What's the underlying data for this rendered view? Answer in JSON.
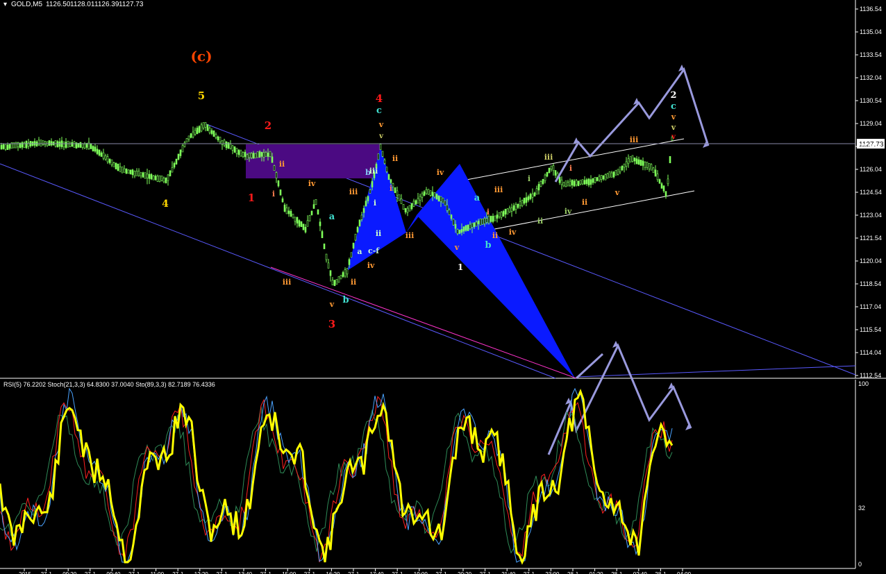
{
  "window": {
    "symbol_label": "GOLD,M5",
    "ohlc": [
      "1126.50",
      "1128.01",
      "1126.39",
      "1127.73"
    ]
  },
  "price_axis": {
    "ticks": [
      "1136.54",
      "1135.04",
      "1133.54",
      "1132.04",
      "1130.54",
      "1129.04",
      "1127.54",
      "1126.04",
      "1124.54",
      "1123.04",
      "1121.54",
      "1120.04",
      "1118.54",
      "1117.04",
      "1115.54",
      "1114.04",
      "1112.54"
    ],
    "current_price": "1127.73"
  },
  "indicator_panel": {
    "label": "RSI(5) 76.2202  Stoch(21,3,3) 64.8300 37.0040  Sto(89,3,3) 82.7189 76.4336",
    "ticks": [
      "100",
      "32",
      "0"
    ]
  },
  "time_axis": {
    "ticks": [
      "2015",
      "27 J",
      "09:20",
      "27 J",
      "09:40",
      "27 J",
      "11:00",
      "27 J",
      "12:20",
      "27 J",
      "13:40",
      "27 J",
      "15:00",
      "27 J",
      "16:20",
      "27 J",
      "17:40",
      "27 J",
      "19:00",
      "27 J",
      "20:20",
      "27 J",
      "21:40",
      "27 J",
      "23:00",
      "28 J",
      "01:20",
      "28 J",
      "02:40",
      "28 J",
      "04:00"
    ]
  },
  "wave_labels": [
    {
      "text": "(c)",
      "color": "#ff4500"
    },
    {
      "text": "5",
      "color": "#ffd700"
    },
    {
      "text": "4",
      "color": "#ffd700"
    },
    {
      "text": "2",
      "color": "#ff1a1a"
    },
    {
      "text": "1",
      "color": "#ff1a1a"
    },
    {
      "text": "ii",
      "color": "#ff9933"
    },
    {
      "text": "i",
      "color": "#ff7f50"
    },
    {
      "text": "iv",
      "color": "#ff9933"
    },
    {
      "text": "iii",
      "color": "#ff9933"
    },
    {
      "text": "3",
      "color": "#ff1a1a"
    },
    {
      "text": "v",
      "color": "#ff9933"
    },
    {
      "text": "b",
      "color": "#40e0d0"
    },
    {
      "text": "a",
      "color": "#40e0d0"
    },
    {
      "text": "ii",
      "color": "#ff9933"
    },
    {
      "text": "iv",
      "color": "#ff9933"
    },
    {
      "text": "a",
      "color": "#ccffcc"
    },
    {
      "text": "c-f",
      "color": "#ccffcc"
    },
    {
      "text": "b",
      "color": "#87cefa"
    },
    {
      "text": "ii",
      "color": "#ccffcc"
    },
    {
      "text": "i",
      "color": "#ccffcc"
    },
    {
      "text": "iii",
      "color": "#ff9933"
    },
    {
      "text": "iii",
      "color": "#ccffcc"
    },
    {
      "text": "4",
      "color": "#ff1a1a"
    },
    {
      "text": "c",
      "color": "#40e0d0"
    },
    {
      "text": "v",
      "color": "#ff9933"
    },
    {
      "text": "v",
      "color": "#cccc66"
    },
    {
      "text": "ii",
      "color": "#ff9933"
    },
    {
      "text": "i",
      "color": "#ff7f50"
    },
    {
      "text": "iii",
      "color": "#ff9933"
    },
    {
      "text": "iv",
      "color": "#ff9933"
    },
    {
      "text": "v",
      "color": "#ff9933"
    },
    {
      "text": "1",
      "color": "#ffffff"
    },
    {
      "text": "a",
      "color": "#40e0d0"
    },
    {
      "text": "b",
      "color": "#40e0d0"
    },
    {
      "text": "i",
      "color": "#ff7f50"
    },
    {
      "text": "ii",
      "color": "#ff9933"
    },
    {
      "text": "iii",
      "color": "#ff9933"
    },
    {
      "text": "iv",
      "color": "#ff9933"
    },
    {
      "text": "iii",
      "color": "#cccc66"
    },
    {
      "text": "i",
      "color": "#ff7f50"
    },
    {
      "text": "i",
      "color": "#99cc66"
    },
    {
      "text": "ii",
      "color": "#99cc66"
    },
    {
      "text": "iv",
      "color": "#99cc66"
    },
    {
      "text": "ii",
      "color": "#ff9933"
    },
    {
      "text": "iii",
      "color": "#ff9933"
    },
    {
      "text": "v",
      "color": "#ff9933"
    },
    {
      "text": "2",
      "color": "#ffffff"
    },
    {
      "text": "c",
      "color": "#40e0d0"
    },
    {
      "text": "v",
      "color": "#ff9933"
    },
    {
      "text": "v",
      "color": "#cccc66"
    },
    {
      "text": "v",
      "color": "#ff1a1a"
    }
  ],
  "colors": {
    "background": "#000000",
    "candles": "#7fff5a",
    "rsi": "#ffff00",
    "stoch_main": "#4aa3ff",
    "stoch_signal": "#ff2020",
    "sto_slow": "#2e8b57",
    "pattern_fill": "#0a1aff",
    "box_fill": "#4b0a82",
    "projection": "#9999dd",
    "trendline": "#5a5aff"
  }
}
